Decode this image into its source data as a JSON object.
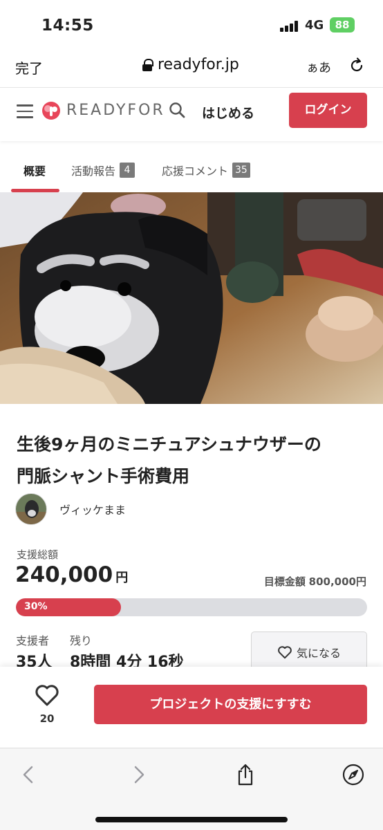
{
  "status_bar": {
    "time": "14:55",
    "network": "4G",
    "battery": "88"
  },
  "browser": {
    "done_label": "完了",
    "url": "readyfor.jp",
    "text_size_label": "ぁあ"
  },
  "header": {
    "logo_text": "READYFOR",
    "start_label": "はじめる",
    "login_label": "ログイン"
  },
  "tabs": [
    {
      "label": "概要",
      "badge": ""
    },
    {
      "label": "活動報告",
      "badge": "4"
    },
    {
      "label": "応援コメント",
      "badge": "35"
    }
  ],
  "project": {
    "title_line1": "生後9ヶ月のミニチュアシュナウザーの",
    "title_line2": "門脈シャント手術費用",
    "owner": "ヴィッケまま"
  },
  "funding": {
    "label": "支援総額",
    "amount": "240,000",
    "unit": "円",
    "goal_label": "目標金額",
    "goal_value": "800,000円",
    "progress_text": "30%",
    "progress": 0.3,
    "supporters_label": "支援者",
    "supporters_value": "35人",
    "remaining_label": "残り",
    "remaining_value": "8時間 4分 16秒",
    "watch_label": "気になる"
  },
  "bottom": {
    "like_count": "20",
    "support_label": "プロジェクトの支援にすすむ"
  },
  "colors": {
    "accent": "#d7404e",
    "battery": "#5fcf63"
  }
}
